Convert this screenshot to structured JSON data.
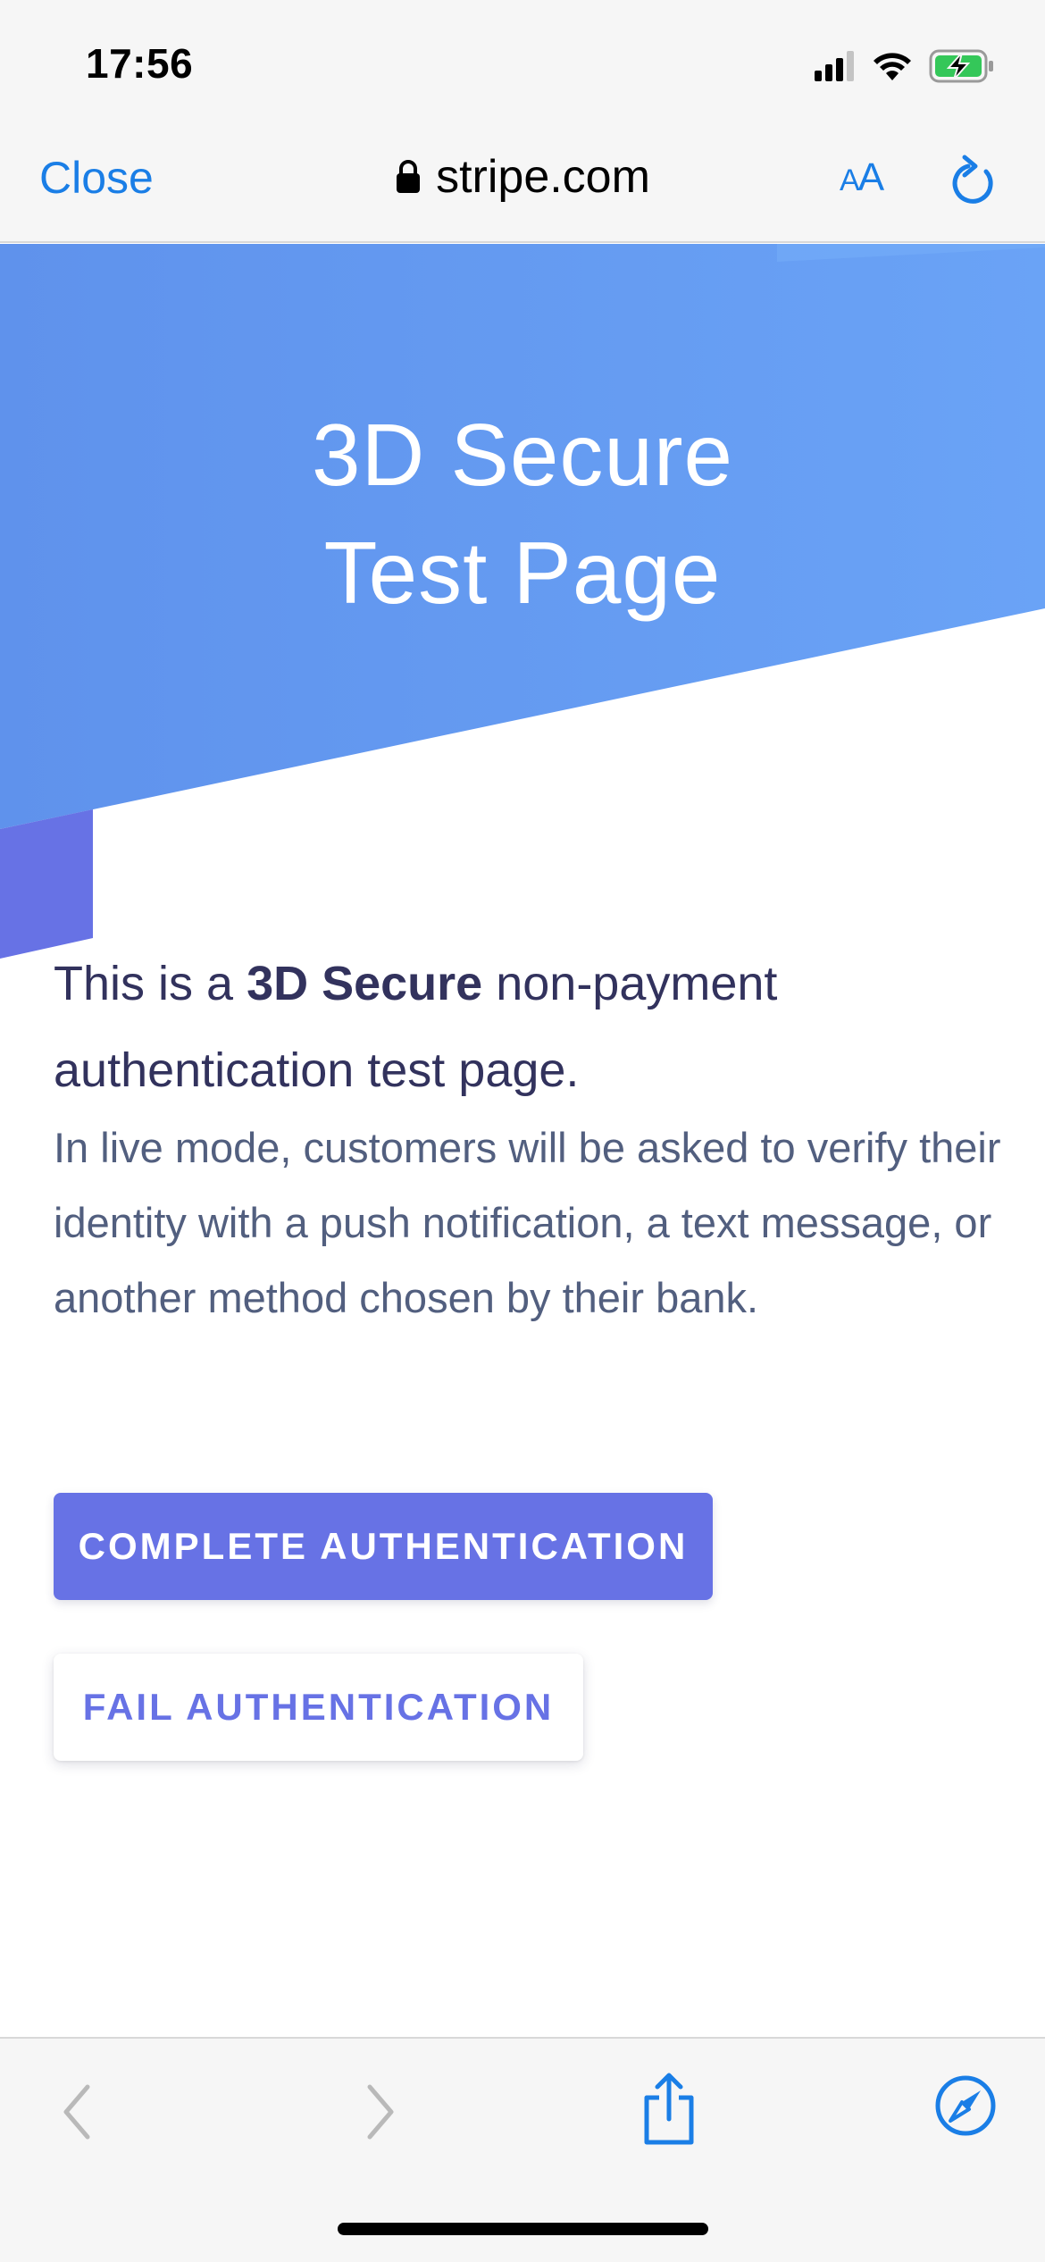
{
  "status_bar": {
    "time": "17:56",
    "icons": [
      "cellular-signal-icon",
      "wifi-icon",
      "battery-charging-icon"
    ]
  },
  "browser": {
    "close_label": "Close",
    "domain": "stripe.com",
    "text_size_label": "AA",
    "icons": [
      "lock-icon",
      "text-size-icon",
      "reload-icon"
    ]
  },
  "page": {
    "hero_title_line1": "3D Secure",
    "hero_title_line2": "Test Page",
    "headline_prefix": "This is a ",
    "headline_bold": "3D Secure",
    "headline_suffix": " non-payment authentication test page.",
    "description": "In live mode, customers will be asked to verify their identity with a push notification, a text message, or another method chosen by their bank.",
    "complete_button_label": "COMPLETE AUTHENTICATION",
    "fail_button_label": "FAIL AUTHENTICATION"
  },
  "toolbar": {
    "icons": [
      "back-icon",
      "forward-icon",
      "share-icon",
      "compass-icon"
    ]
  },
  "colors": {
    "accent": "#1a7ee6",
    "hero_blue": "#6ba2f5",
    "stripe_purple": "#6772e5",
    "heading_text": "#32325d",
    "body_text": "#525f7f"
  }
}
